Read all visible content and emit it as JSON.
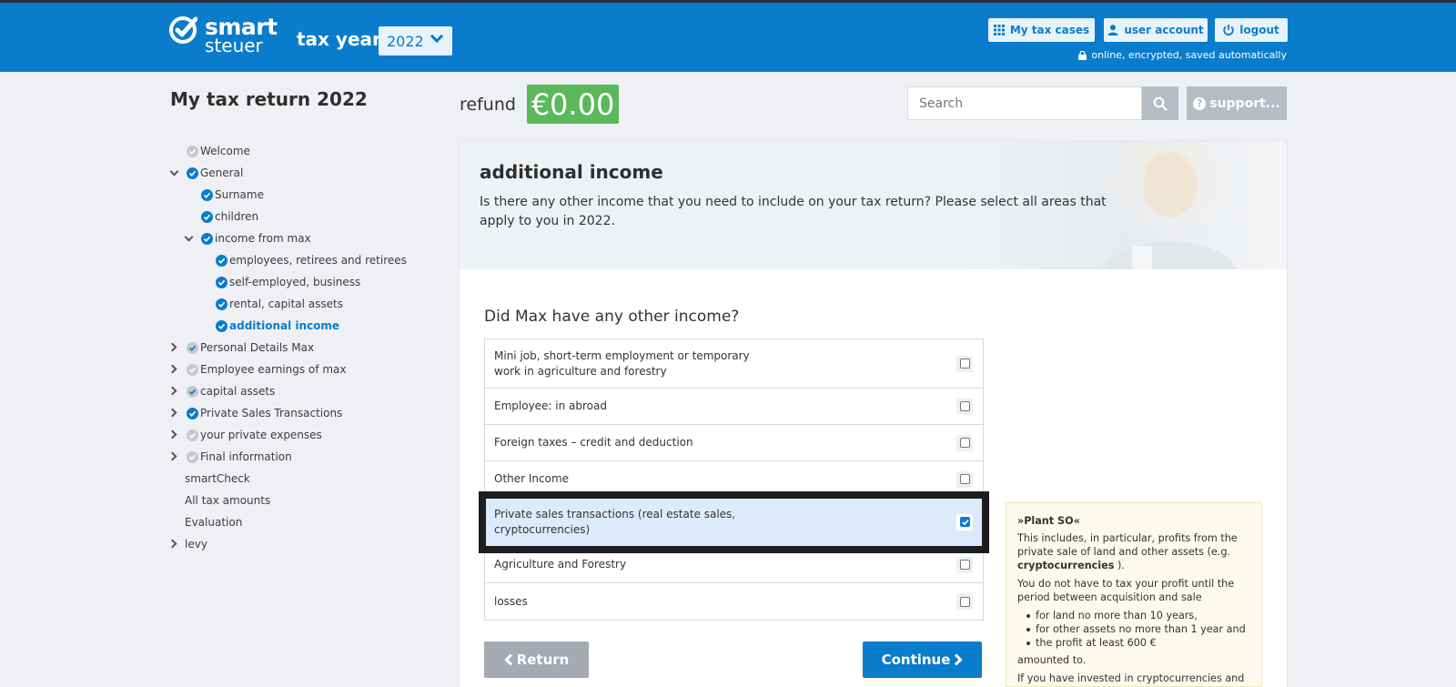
{
  "header": {
    "logo_top": "smart",
    "logo_bottom": "steuer",
    "tax_year_label": "tax year",
    "tax_year_value": "2022",
    "btn_cases": "My tax cases",
    "btn_account": "user account",
    "btn_logout": "logout",
    "secure_note": "online, encrypted, saved automatically"
  },
  "title_row": {
    "page_title": "My tax return 2022",
    "refund_label": "refund",
    "refund_amount": "€0.00",
    "search_placeholder": "Search",
    "support_label": "support..."
  },
  "sidebar": {
    "items": [
      {
        "label": "Welcome"
      },
      {
        "label": "General"
      },
      {
        "label": "Surname"
      },
      {
        "label": "children"
      },
      {
        "label": "income from max"
      },
      {
        "label": "employees, retirees and retirees"
      },
      {
        "label": "self-employed, business"
      },
      {
        "label": "rental, capital assets"
      },
      {
        "label": "additional income"
      },
      {
        "label": "Personal Details Max"
      },
      {
        "label": "Employee earnings of max"
      },
      {
        "label": "capital assets"
      },
      {
        "label": "Private Sales Transactions"
      },
      {
        "label": "your private expenses"
      },
      {
        "label": "Final information"
      },
      {
        "label": "smartCheck"
      },
      {
        "label": "All tax amounts"
      },
      {
        "label": "Evaluation"
      },
      {
        "label": "levy"
      }
    ]
  },
  "main": {
    "title": "additional income",
    "description": "Is there any other income that you need to include on your tax return? Please select all areas that apply to you in 2022.",
    "question": "Did Max have any other income?",
    "options": [
      {
        "label": "Mini job, short-term employment or temporary work in agriculture and forestry",
        "checked": false
      },
      {
        "label": "Employee: in abroad",
        "checked": false
      },
      {
        "label": "Foreign taxes – credit and deduction",
        "checked": false
      },
      {
        "label": "Other Income",
        "checked": false
      },
      {
        "label": "Private sales transactions (real estate sales, cryptocurrencies)",
        "checked": true
      },
      {
        "label": "Agriculture and Forestry",
        "checked": false
      },
      {
        "label": "losses",
        "checked": false
      }
    ],
    "btn_return": "Return",
    "btn_continue": "Continue"
  },
  "help": {
    "title": "»Plant SO«",
    "p1_a": "This includes, in particular, profits from the private sale of land and other assets (e.g. ",
    "p1_bold": "cryptocurrencies",
    "p1_b": " ).",
    "p2": "You do not have to tax your profit until the period between acquisition and sale",
    "bullets": [
      "for land no more than 10 years,",
      "for other assets no more than 1 year and",
      "the profit at least 600 €"
    ],
    "p3": "amounted to.",
    "p4": "If you have invested in cryptocurrencies and"
  },
  "colors": {
    "brand_blue": "#0a7ccc",
    "refund_green": "#5cb85c",
    "button_gray": "#a4aab2"
  }
}
